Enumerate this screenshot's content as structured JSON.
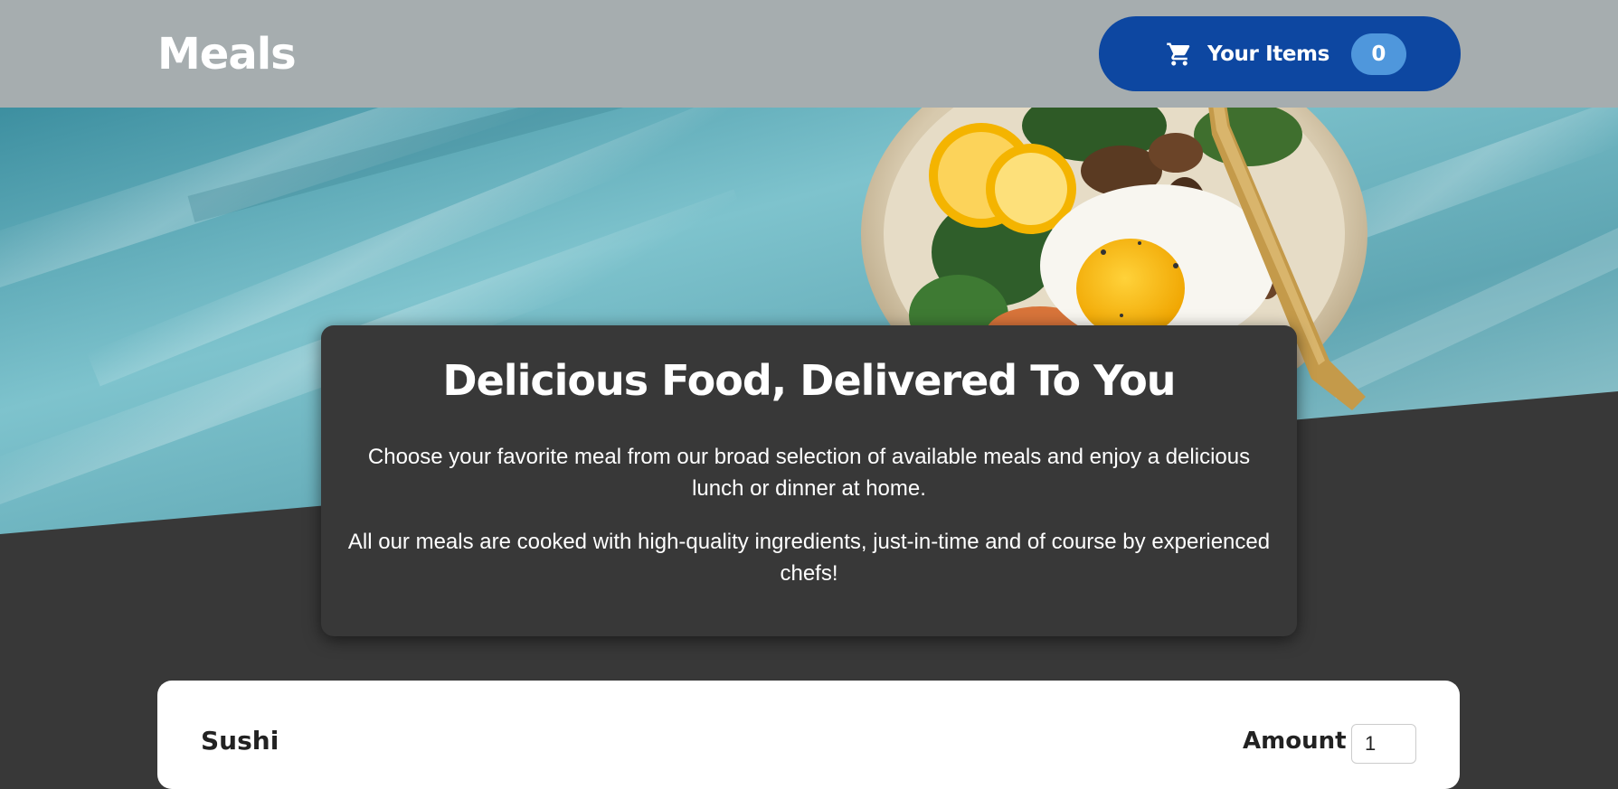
{
  "header": {
    "title": "Meals",
    "cart": {
      "label": "Your Items",
      "count": "0",
      "icon": "cart-icon"
    },
    "colors": {
      "background": "#a6adaf",
      "cart_button": "#0d47a1",
      "badge": "#4f97dc"
    }
  },
  "summary": {
    "title": "Delicious Food, Delivered To You",
    "paragraph1": "Choose your favorite meal from our broad selection of available meals and enjoy a delicious lunch or dinner at home.",
    "paragraph2": "All our meals are cooked with high-quality ingredients, just-in-time and of course by experienced chefs!"
  },
  "meals": {
    "items": [
      {
        "name": "Sushi",
        "amount_label": "Amount",
        "amount_value": "1"
      }
    ]
  },
  "theme": {
    "page_background": "#383838",
    "card_background": "#383838",
    "hero_background": "#5fa6b3"
  }
}
